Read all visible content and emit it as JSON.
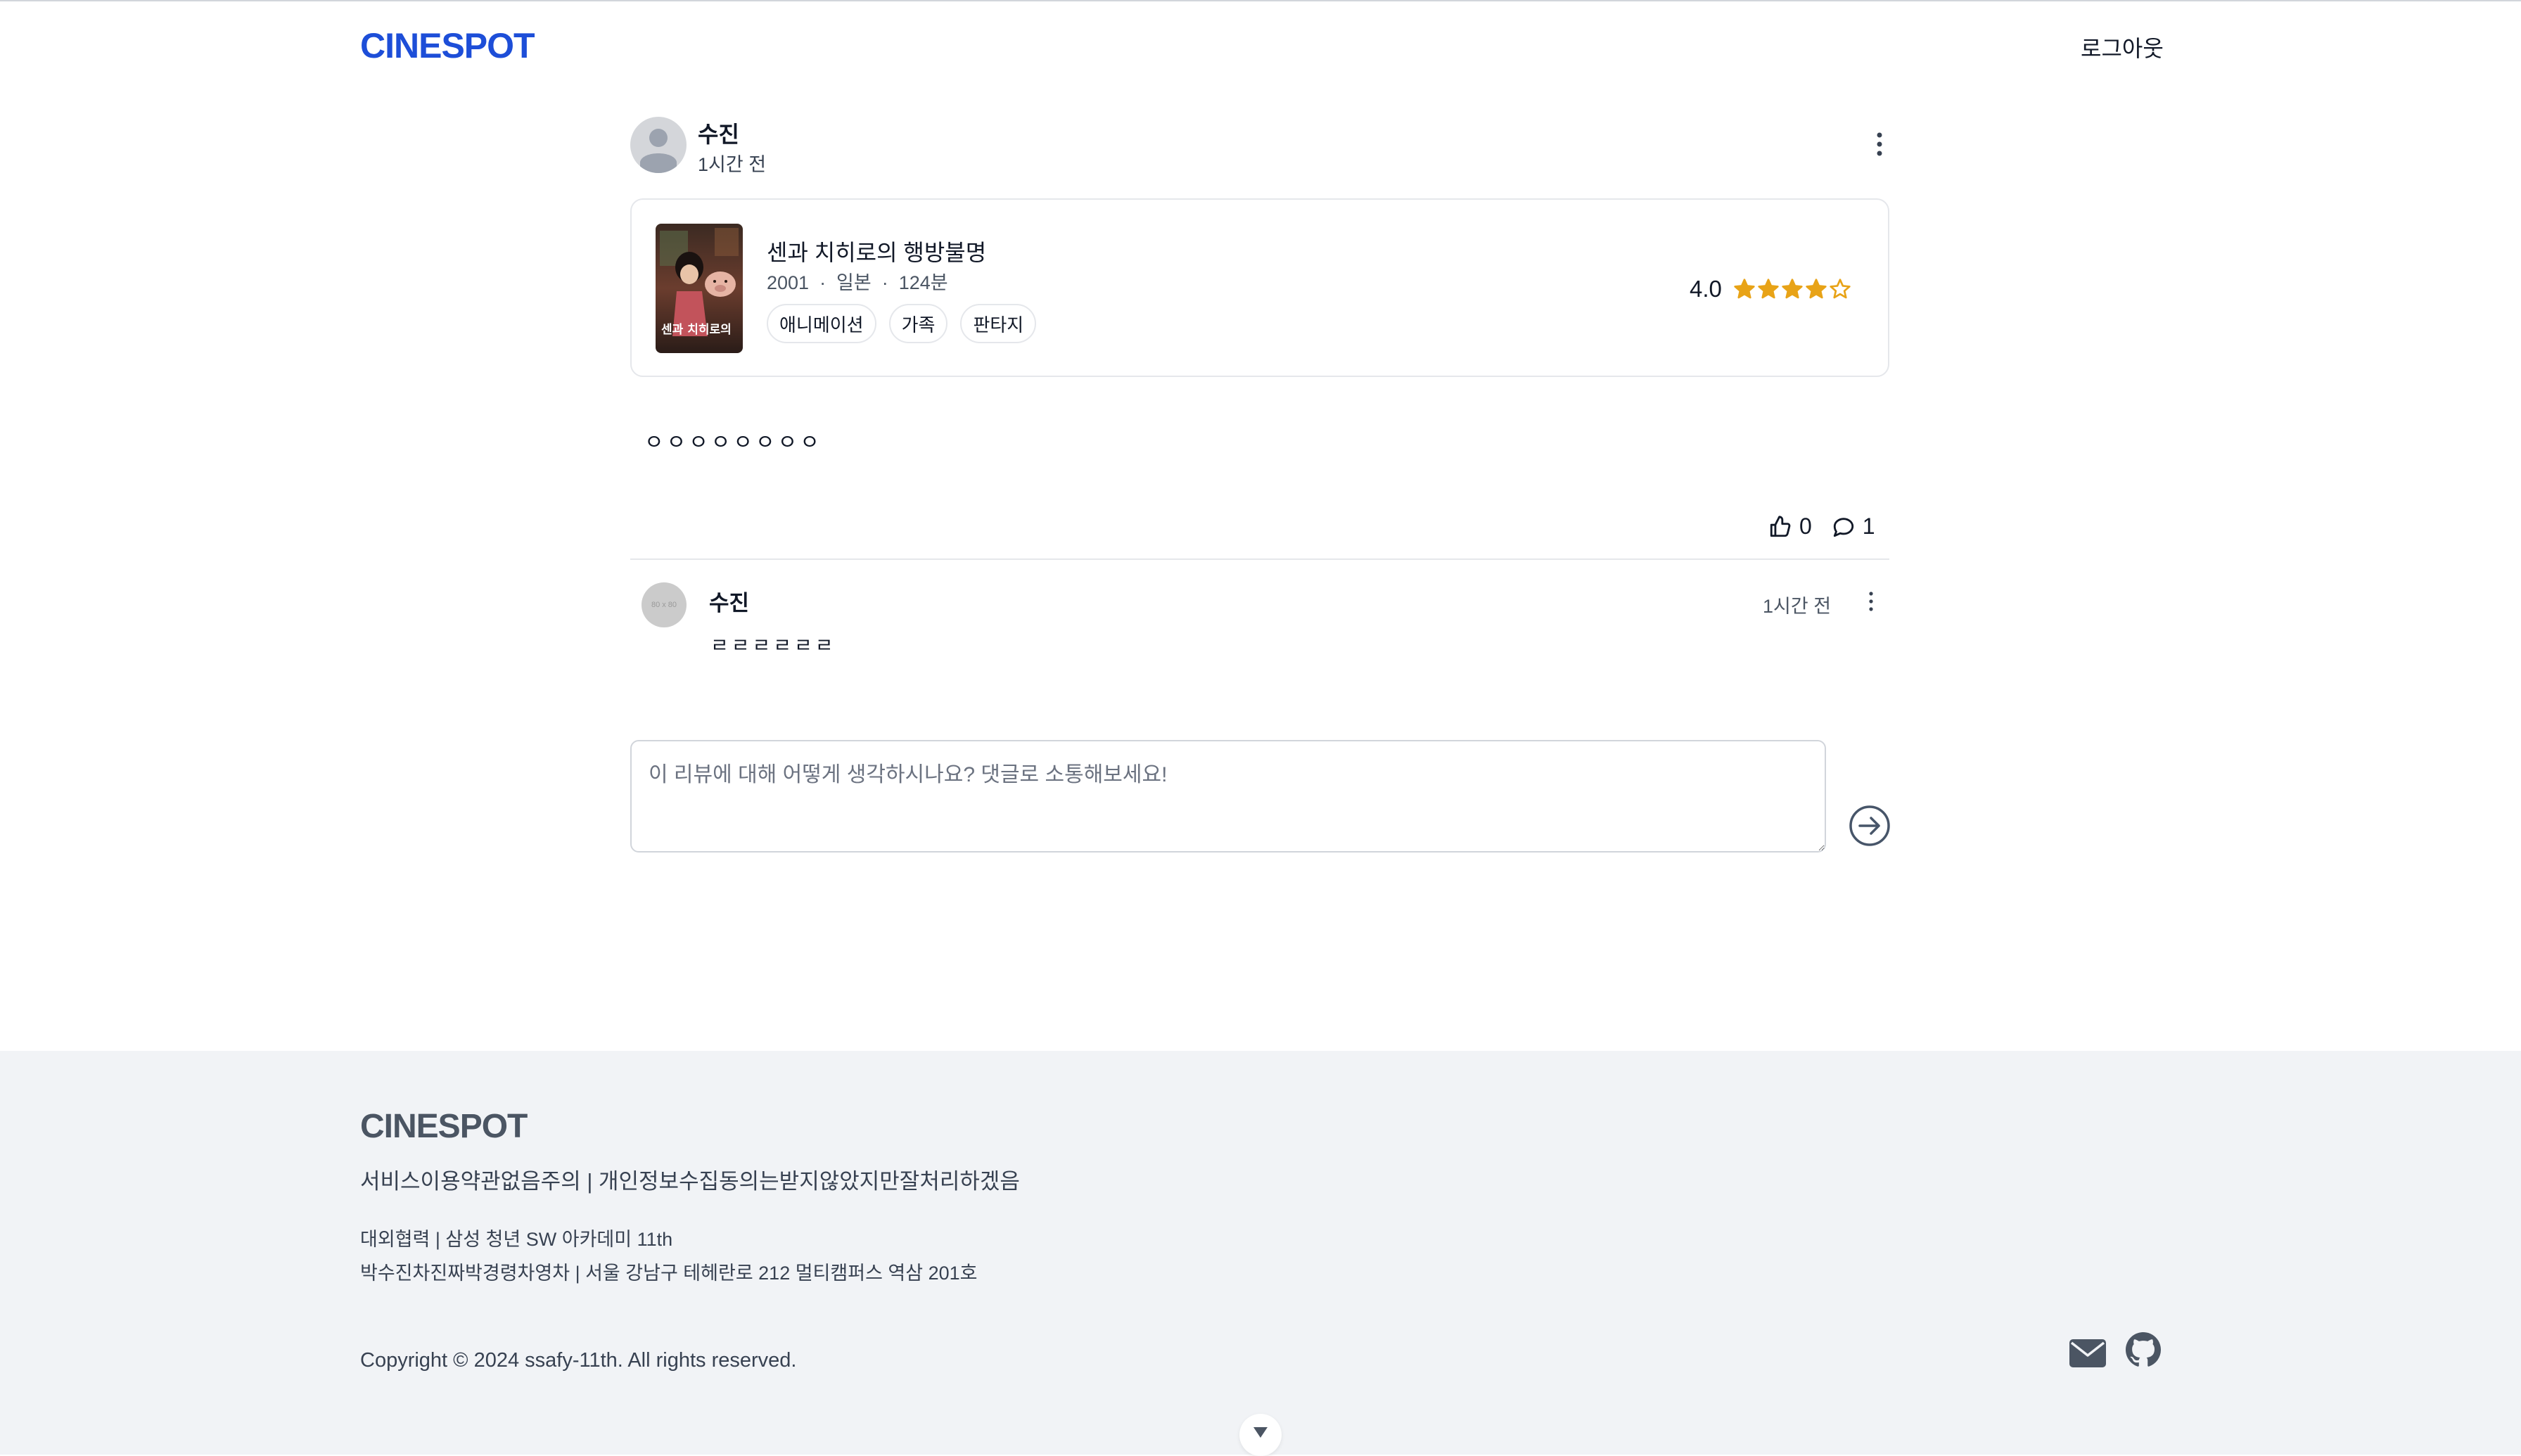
{
  "header": {
    "logo": "CINESPOT",
    "logout_label": "로그아웃"
  },
  "review": {
    "author": "수진",
    "time": "1시간 전",
    "movie": {
      "title": "센과 치히로의 행방불명",
      "meta": "2001  ·  일본  ·  124분",
      "genres": [
        "애니메이션",
        "가족",
        "판타지"
      ],
      "rating_value": "4.0",
      "rating_stars": 4,
      "rating_max": 5,
      "poster_text": "센과 치히로의"
    },
    "body": "ㅇㅇㅇㅇㅇㅇㅇㅇ",
    "like_count": "0",
    "comment_count": "1"
  },
  "comments": [
    {
      "author": "수진",
      "time": "1시간 전",
      "text": "ㄹㄹㄹㄹㄹㄹ",
      "avatar_placeholder": "80 x 80"
    }
  ],
  "comment_form": {
    "placeholder": "이 리뷰에 대해 어떻게 생각하시나요? 댓글로 소통해보세요!"
  },
  "footer": {
    "logo": "CINESPOT",
    "policy": "서비스이용약관없음주의 | 개인정보수집동의는받지않았지만잘처리하겠음",
    "partner": "대외협력 | 삼성 청년 SW 아카데미 11th",
    "members": "박수진차진짜박경령차영차 | 서울 강남구 테헤란로 212 멀티캠퍼스 역삼 201호",
    "copyright": "Copyright © 2024 ssafy-11th. All rights reserved."
  },
  "colors": {
    "brand": "#1d4ed8",
    "star": "#e8a317",
    "footer_bg": "#f1f3f6"
  }
}
